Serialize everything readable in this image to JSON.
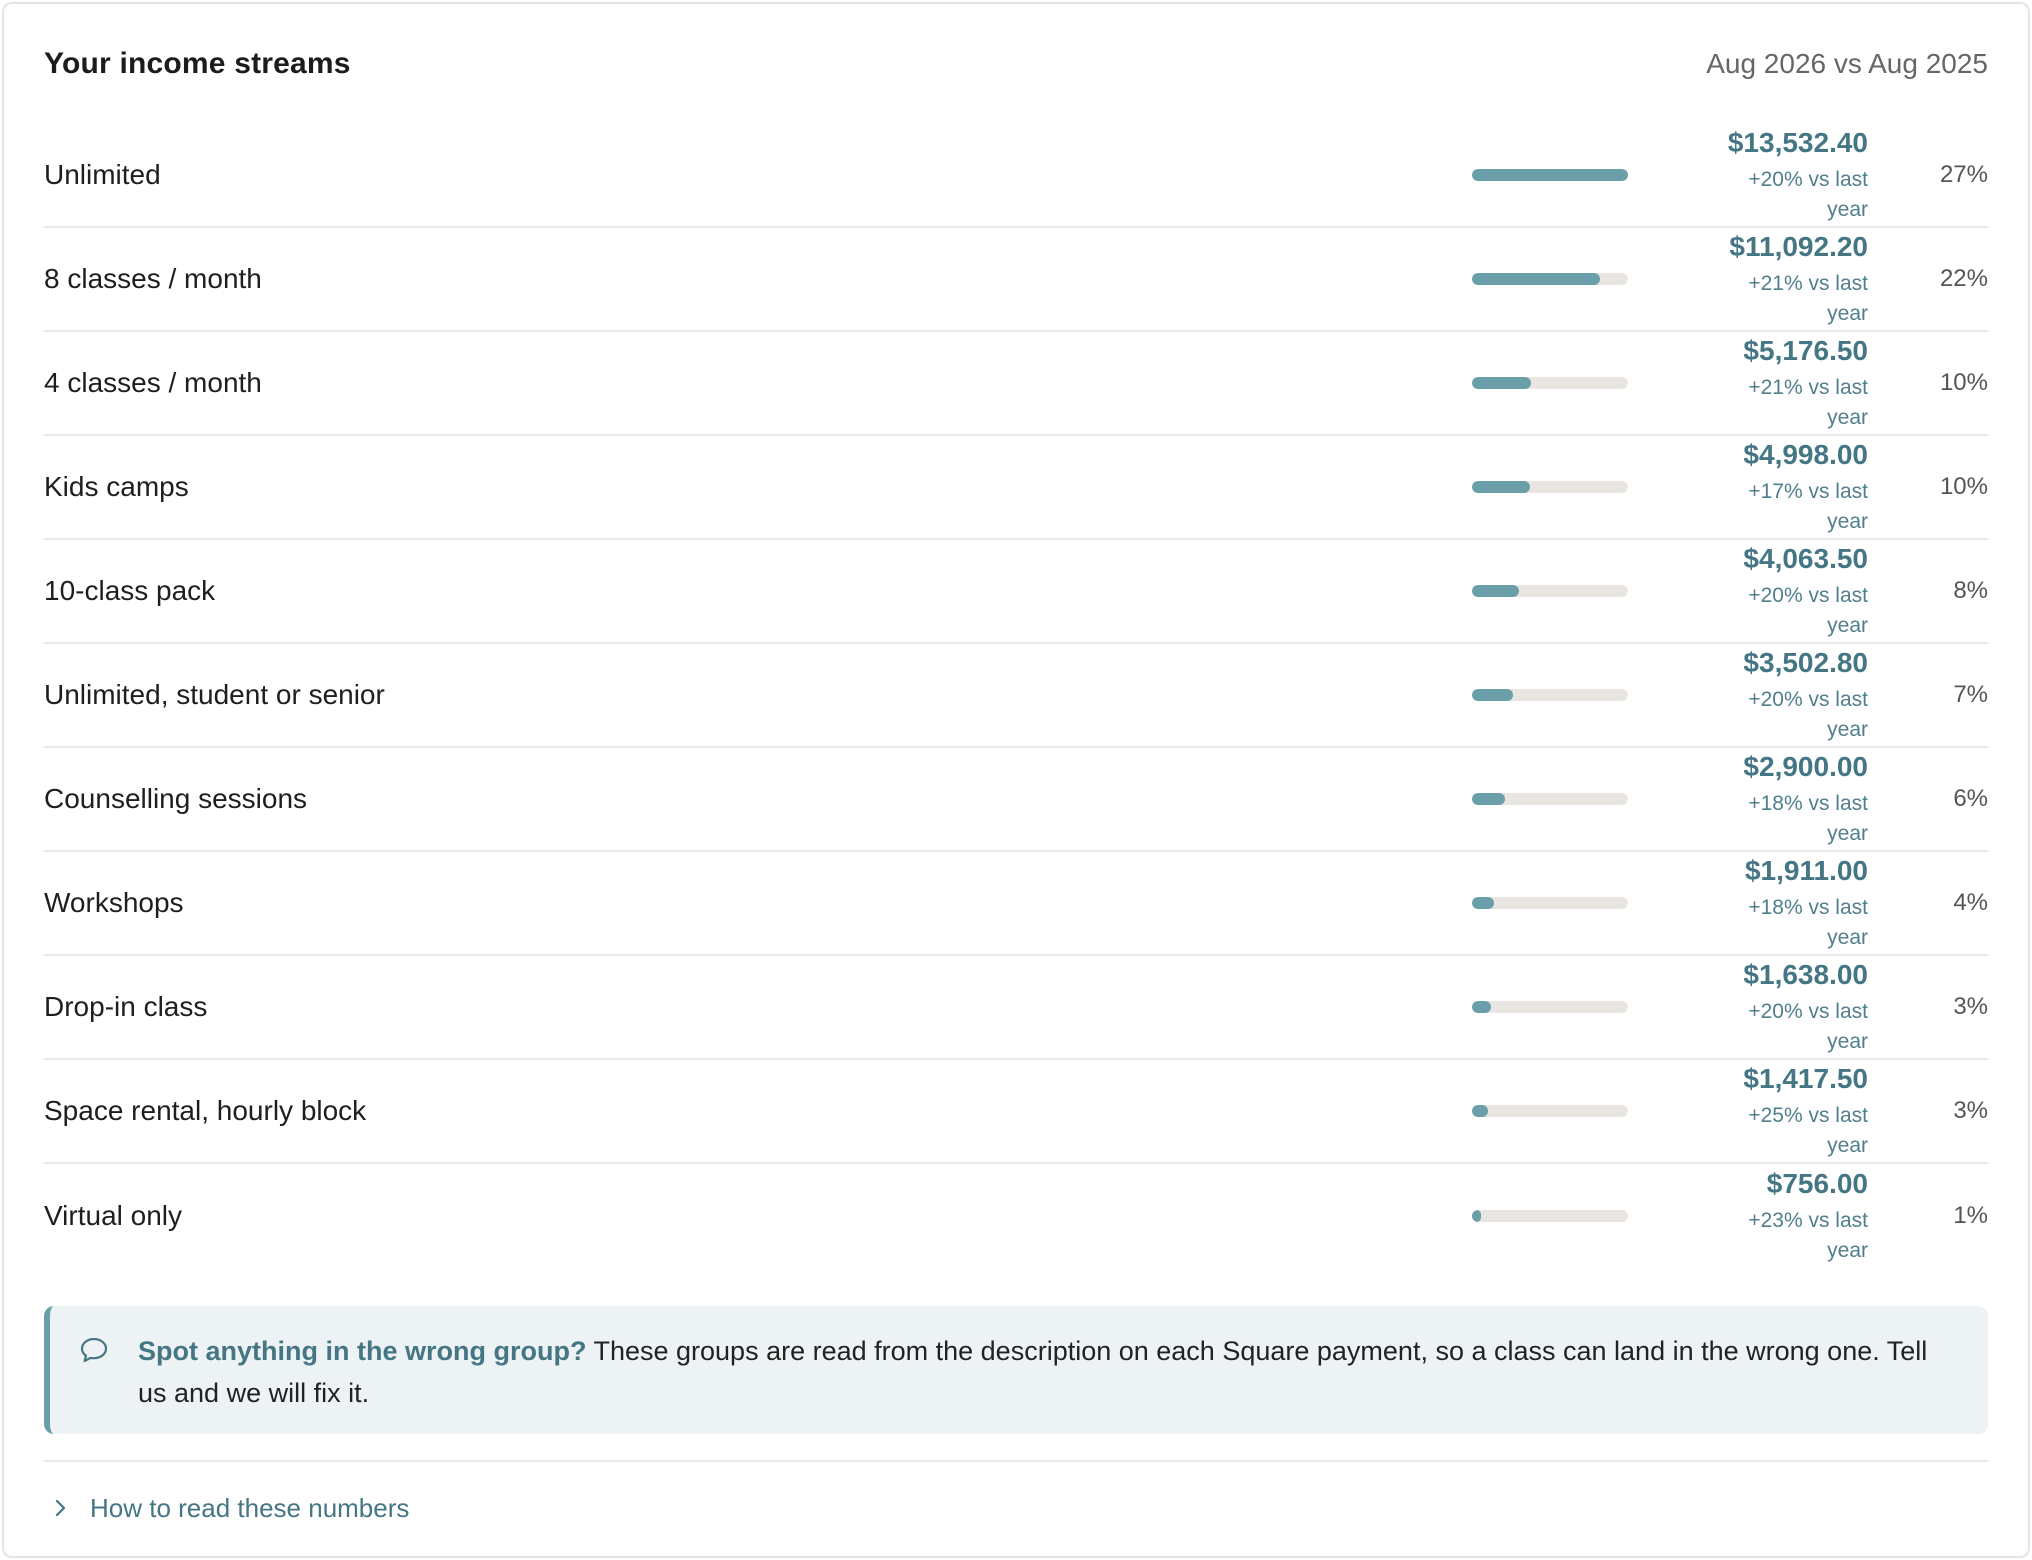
{
  "header": {
    "title": "Your income streams",
    "period": "Aug 2026 vs Aug 2025"
  },
  "streams": [
    {
      "name": "Unlimited",
      "amount": "$13,532.40",
      "change": "+20% vs last year",
      "share": "27%",
      "share_value": 100
    },
    {
      "name": "8 classes / month",
      "amount": "$11,092.20",
      "change": "+21% vs last year",
      "share": "22%",
      "share_value": 82
    },
    {
      "name": "4 classes / month",
      "amount": "$5,176.50",
      "change": "+21% vs last year",
      "share": "10%",
      "share_value": 38
    },
    {
      "name": "Kids camps",
      "amount": "$4,998.00",
      "change": "+17% vs last year",
      "share": "10%",
      "share_value": 37
    },
    {
      "name": "10-class pack",
      "amount": "$4,063.50",
      "change": "+20% vs last year",
      "share": "8%",
      "share_value": 30
    },
    {
      "name": "Unlimited, student or senior",
      "amount": "$3,502.80",
      "change": "+20% vs last year",
      "share": "7%",
      "share_value": 26
    },
    {
      "name": "Counselling sessions",
      "amount": "$2,900.00",
      "change": "+18% vs last year",
      "share": "6%",
      "share_value": 21
    },
    {
      "name": "Workshops",
      "amount": "$1,911.00",
      "change": "+18% vs last year",
      "share": "4%",
      "share_value": 14
    },
    {
      "name": "Drop-in class",
      "amount": "$1,638.00",
      "change": "+20% vs last year",
      "share": "3%",
      "share_value": 12
    },
    {
      "name": "Space rental, hourly block",
      "amount": "$1,417.50",
      "change": "+25% vs last year",
      "share": "3%",
      "share_value": 10
    },
    {
      "name": "Virtual only",
      "amount": "$756.00",
      "change": "+23% vs last year",
      "share": "1%",
      "share_value": 6
    }
  ],
  "notice": {
    "icon": "speech-bubble-icon",
    "strong": "Spot anything in the wrong group?",
    "text": " These groups are read from the description on each Square payment, so a class can land in the wrong one. Tell us and we will fix it."
  },
  "footer": {
    "icon": "chevron-right-icon",
    "link_label": "How to read these numbers"
  },
  "colors": {
    "accent": "#447684",
    "bar_fill": "#6a9ea9",
    "bar_track": "#e9e6e1",
    "notice_bg": "#edf2f4"
  }
}
